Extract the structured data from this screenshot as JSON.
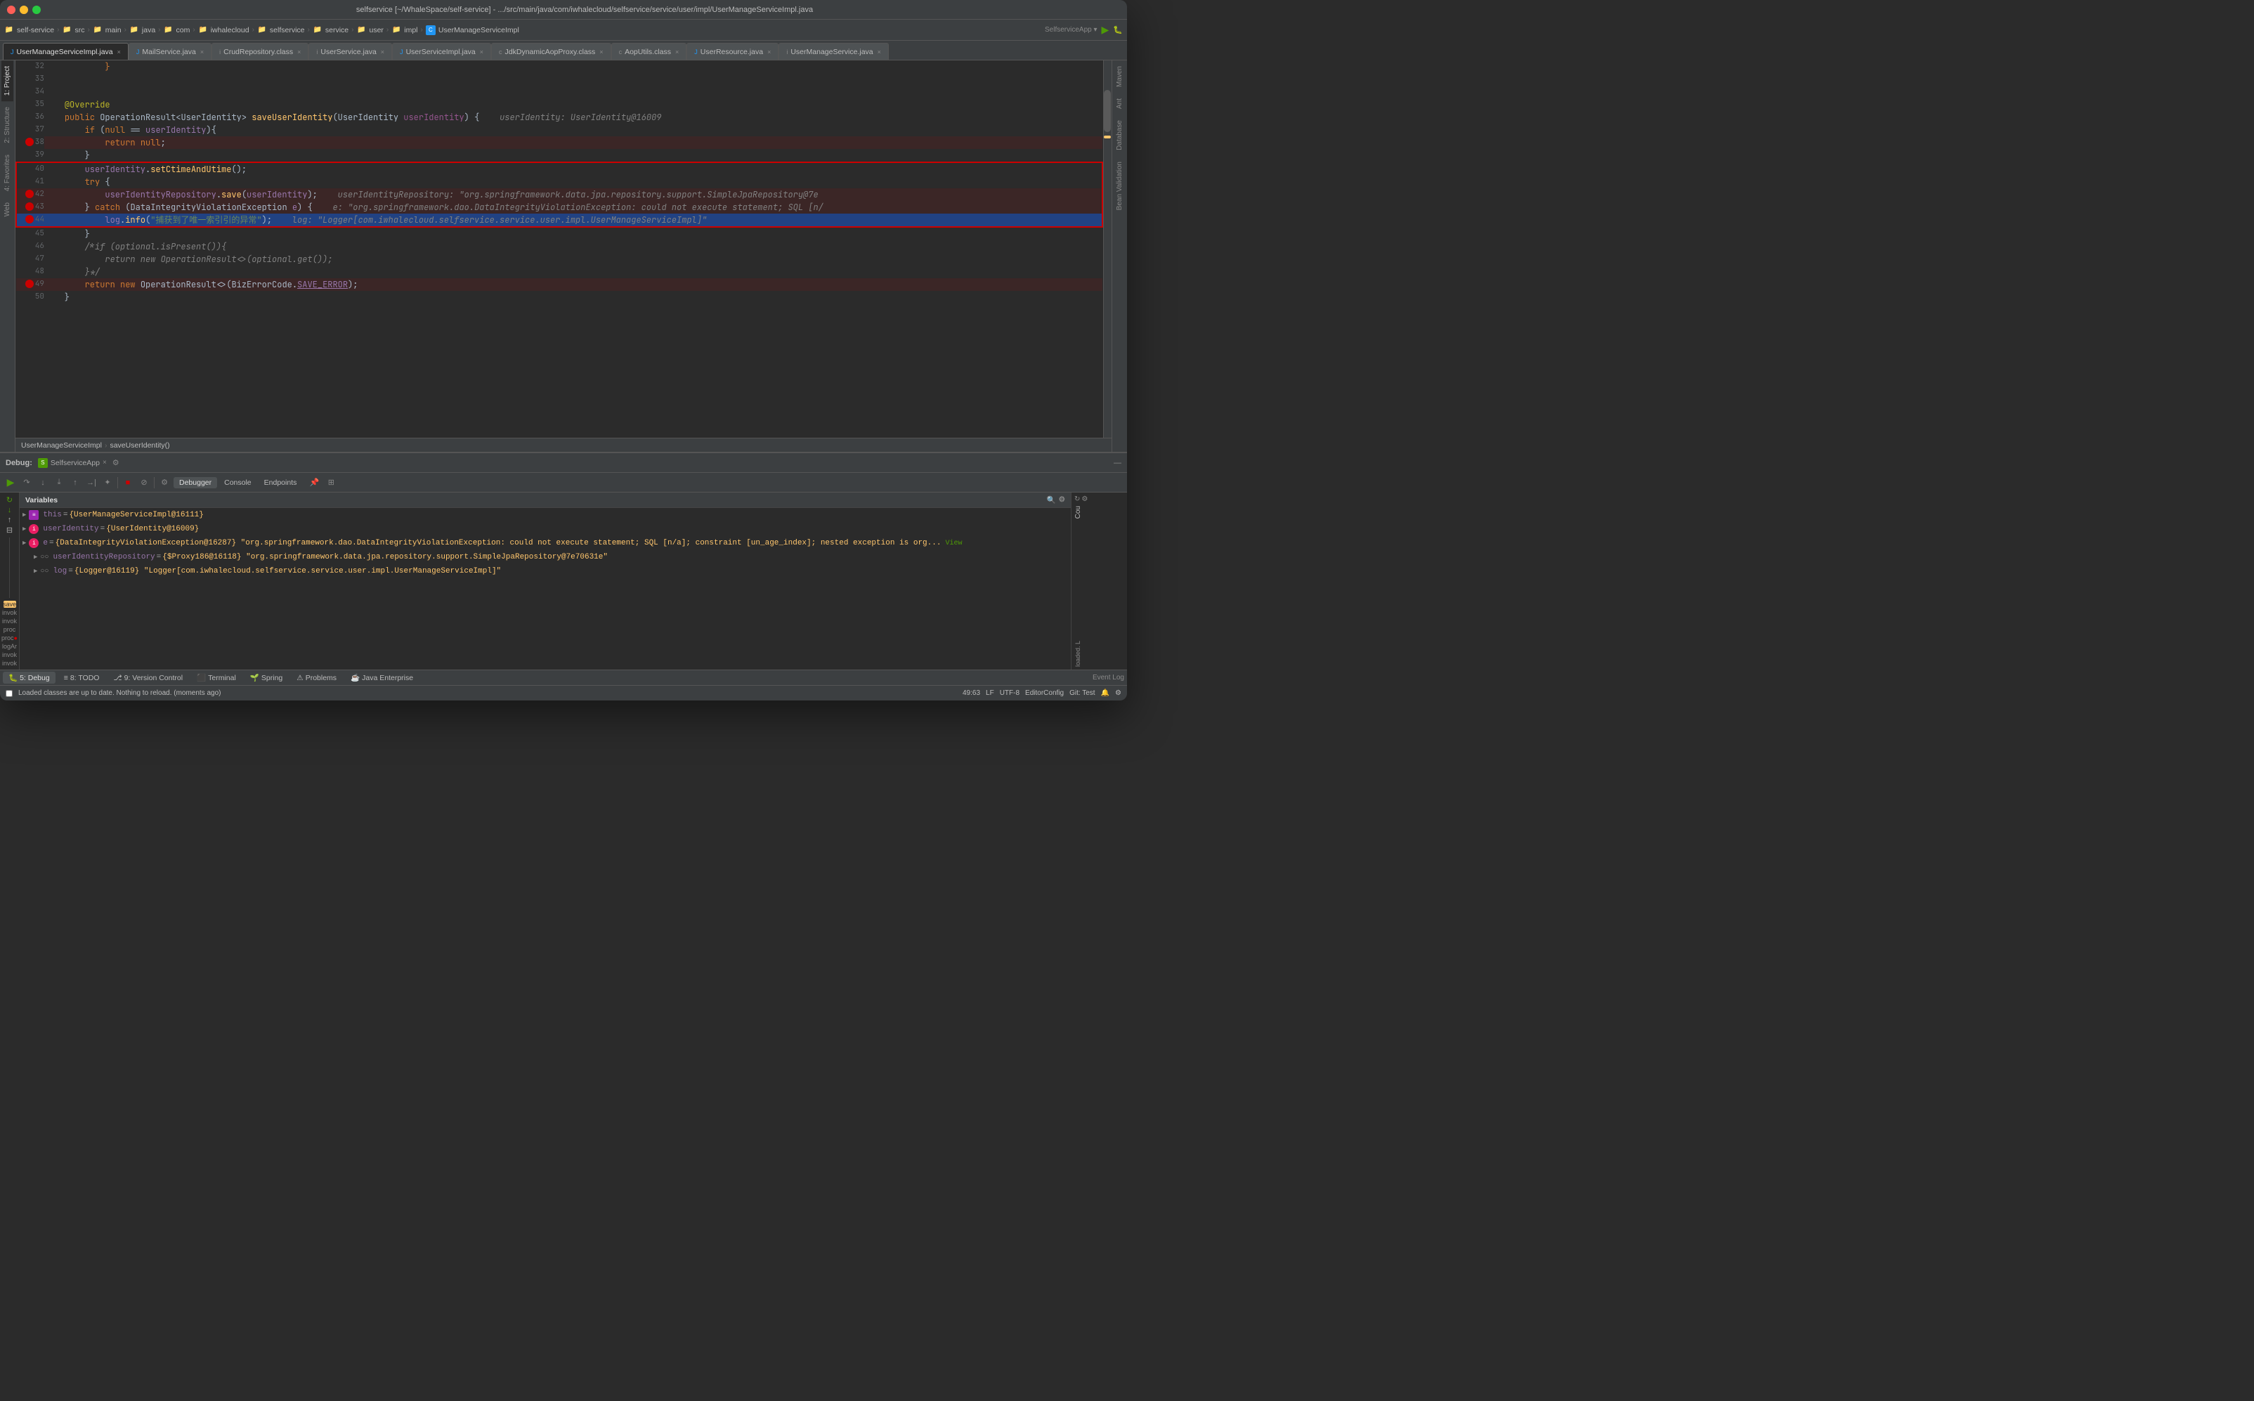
{
  "window": {
    "title": "selfservice [~/WhaleSpace/self-service] - .../src/main/java/com/iwhalecloud/selfservice/service/user/impl/UserManageServiceImpl.java"
  },
  "navbar": {
    "items": [
      "self-service",
      "src",
      "main",
      "java",
      "com",
      "iwhalecloud",
      "selfservice",
      "service",
      "user",
      "impl",
      "UserManageServiceImpl"
    ]
  },
  "tabs": [
    {
      "label": "UserManageServiceImpl.java",
      "active": true,
      "modified": false
    },
    {
      "label": "MailService.java",
      "active": false
    },
    {
      "label": "CrudRepository.class",
      "active": false
    },
    {
      "label": "UserService.java",
      "active": false
    },
    {
      "label": "UserServiceImpl.java",
      "active": false
    },
    {
      "label": "JdkDynamicAopProxy.class",
      "active": false
    },
    {
      "label": "AopUtils.class",
      "active": false
    },
    {
      "label": "UserResource.java",
      "active": false
    },
    {
      "label": "UserManageService.java",
      "active": false
    }
  ],
  "code": {
    "lines": [
      {
        "num": 32,
        "content": "            }"
      },
      {
        "num": 33,
        "content": ""
      },
      {
        "num": 34,
        "content": ""
      },
      {
        "num": 35,
        "content": "    @Override"
      },
      {
        "num": 36,
        "content": "    public OperationResult<UserIdentity> saveUserIdentity(UserIdentity userIdentity) {    userIdentity: UserIdentity@16009"
      },
      {
        "num": 37,
        "content": "        if (null == userIdentity){"
      },
      {
        "num": 38,
        "content": "            return null;",
        "breakpoint": true
      },
      {
        "num": 39,
        "content": "        }"
      },
      {
        "num": 40,
        "content": "        userIdentity.setCtimeAndUtime();"
      },
      {
        "num": 41,
        "content": "        try {"
      },
      {
        "num": 42,
        "content": "            userIdentityRepository.save(userIdentity);    userIdentityRepository: \"org.springframework.data.jpa.repository.support.SimpleJpaRepository@7e",
        "breakpoint": true
      },
      {
        "num": 43,
        "content": "        } catch (DataIntegrityViolationException e) {    e: \"org.springframework.dao.DataIntegrityViolationException: could not execute statement; SQL [n/",
        "breakpoint": true
      },
      {
        "num": 44,
        "content": "            log.info(\"捕获到了唯一索引引的异常\");    log: \"Logger[com.iwhalecloud.selfservice.service.user.impl.UserManageServiceImpl]\"",
        "breakpoint": true,
        "selected": true
      },
      {
        "num": 45,
        "content": "        }"
      },
      {
        "num": 46,
        "content": "        /*if (optional.isPresent()){"
      },
      {
        "num": 47,
        "content": "            return new OperationResult<>(optional.get());"
      },
      {
        "num": 48,
        "content": "        }*/"
      },
      {
        "num": 49,
        "content": "        return new OperationResult<>(BizErrorCode.SAVE_ERROR);",
        "breakpoint": true
      },
      {
        "num": 50,
        "content": "    }"
      }
    ]
  },
  "breadcrumb": {
    "items": [
      "UserManageServiceImpl",
      "saveUserIdentity()"
    ]
  },
  "debug": {
    "session_label": "SelfserviceApp",
    "tabs": [
      "Debugger",
      "Console",
      "Endpoints"
    ],
    "variables_header": "Variables",
    "variables": [
      {
        "indent": 0,
        "icon": "this",
        "name": "this",
        "value": "= {UserManageServiceImpl@16111}"
      },
      {
        "indent": 0,
        "icon": "obj",
        "name": "userIdentity",
        "value": "= {UserIdentity@16009}"
      },
      {
        "indent": 0,
        "icon": "obj",
        "name": "e",
        "value": "= {DataIntegrityViolationException@16287} \"org.springframework.dao.DataIntegrityViolationException: could not execute statement; SQL [n/a]; constraint [un_age_index]; nested exception is org..."
      },
      {
        "indent": 1,
        "icon": "field",
        "name": "userIdentityRepository",
        "value": "= {$Proxy186@16118} \"org.springframework.data.jpa.repository.support.SimpleJpaRepository@7e70631e\""
      },
      {
        "indent": 1,
        "icon": "field",
        "name": "log",
        "value": "= {Logger@16119} \"Logger[com.iwhalecloud.selfservice.service.user.impl.UserManageServiceImpl]\""
      }
    ],
    "call_stack": [
      {
        "label": "save",
        "active": false
      },
      {
        "label": "invok",
        "active": false
      },
      {
        "label": "invok",
        "active": false
      },
      {
        "label": "proc",
        "active": false
      },
      {
        "label": "proc ●",
        "active": false
      },
      {
        "label": "logAr",
        "active": false
      },
      {
        "label": "invok",
        "active": false
      },
      {
        "label": "invok",
        "active": false
      }
    ]
  },
  "status_bar": {
    "message": "Loaded classes are up to date. Nothing to reload. (moments ago)",
    "position": "49:63",
    "encoding": "LF  UTF-8",
    "indent": "EditorConfig",
    "git": "Git: Test"
  },
  "bottom_tabs": [
    {
      "num": 5,
      "label": "Debug",
      "active": true
    },
    {
      "num": 8,
      "label": "TODO"
    },
    {
      "num": 9,
      "label": "Version Control"
    },
    {
      "num": "",
      "label": "Terminal"
    },
    {
      "num": "",
      "label": "Spring"
    },
    {
      "num": "",
      "label": "Problems"
    },
    {
      "num": "",
      "label": "Java Enterprise"
    }
  ],
  "right_panels": [
    "Maven",
    "Ant",
    "Database",
    "Bean Validation"
  ],
  "left_panels": [
    "1: Project",
    "2: Structure",
    "4: Favorites",
    "Web"
  ]
}
